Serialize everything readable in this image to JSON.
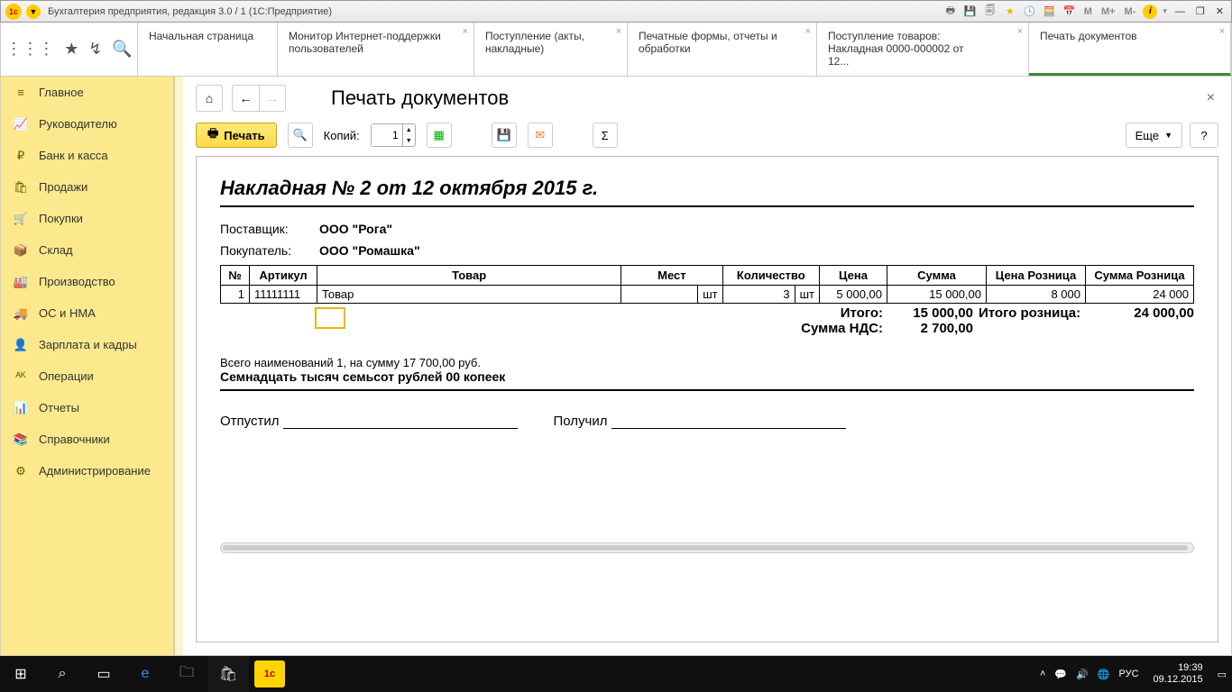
{
  "titlebar": {
    "title": "Бухгалтерия предприятия, редакция 3.0 / 1  (1С:Предприятие)",
    "buttons": {
      "m": "M",
      "mplus": "M+",
      "mminus": "M-"
    }
  },
  "tabs": [
    {
      "label": "Начальная страница",
      "closable": false
    },
    {
      "label": "Монитор Интернет-поддержки пользователей",
      "closable": true
    },
    {
      "label": "Поступление (акты, накладные)",
      "closable": true
    },
    {
      "label": "Печатные формы, отчеты и обработки",
      "closable": true
    },
    {
      "label": "Поступление товаров: Накладная 0000-000002 от 12...",
      "closable": true
    },
    {
      "label": "Печать документов",
      "closable": true,
      "active": true
    }
  ],
  "sidebar": [
    {
      "icon": "≡",
      "label": "Главное"
    },
    {
      "icon": "📈",
      "label": "Руководителю"
    },
    {
      "icon": "₽",
      "label": "Банк и касса"
    },
    {
      "icon": "🛍",
      "label": "Продажи"
    },
    {
      "icon": "🛒",
      "label": "Покупки"
    },
    {
      "icon": "📦",
      "label": "Склад"
    },
    {
      "icon": "🏭",
      "label": "Производство"
    },
    {
      "icon": "🚚",
      "label": "ОС и НМА"
    },
    {
      "icon": "👤",
      "label": "Зарплата и кадры"
    },
    {
      "icon": "ᴬᴷ",
      "label": "Операции"
    },
    {
      "icon": "📊",
      "label": "Отчеты"
    },
    {
      "icon": "📚",
      "label": "Справочники"
    },
    {
      "icon": "⚙",
      "label": "Администрирование"
    }
  ],
  "page": {
    "heading": "Печать документов",
    "print_label": "Печать",
    "copies_label": "Копий:",
    "copies_value": "1",
    "more_label": "Еще",
    "help_label": "?"
  },
  "document": {
    "title": "Накладная № 2 от 12 октября 2015 г.",
    "supplier_label": "Поставщик:",
    "supplier": "ООО \"Рога\"",
    "buyer_label": "Покупатель:",
    "buyer": "ООО \"Ромашка\"",
    "cols": {
      "num": "№",
      "art": "Артикул",
      "goods": "Товар",
      "places": "Мест",
      "qty": "Количество",
      "price": "Цена",
      "sum": "Сумма",
      "retail_price": "Цена Розница",
      "retail_sum": "Сумма Розница"
    },
    "rows": [
      {
        "num": "1",
        "art": "11111111",
        "goods": "Товар",
        "places_unit": "шт",
        "qty": "3",
        "qty_unit": "шт",
        "price": "5 000,00",
        "sum": "15 000,00",
        "retail_price": "8 000",
        "retail_sum": "24 000"
      }
    ],
    "totals": {
      "total_label": "Итого:",
      "total_value": "15 000,00",
      "retail_total_label": "Итого розница:",
      "retail_total_value": "24 000,00",
      "vat_label": "Сумма НДС:",
      "vat_value": "2 700,00"
    },
    "summary_line": "Всего наименований 1, на сумму 17 700,00 руб.",
    "summary_words": "Семнадцать тысяч семьсот рублей 00 копеек",
    "sign_out": "Отпустил",
    "sign_in": "Получил"
  },
  "taskbar": {
    "lang": "РУС",
    "time": "19:39",
    "date": "09.12.2015"
  }
}
